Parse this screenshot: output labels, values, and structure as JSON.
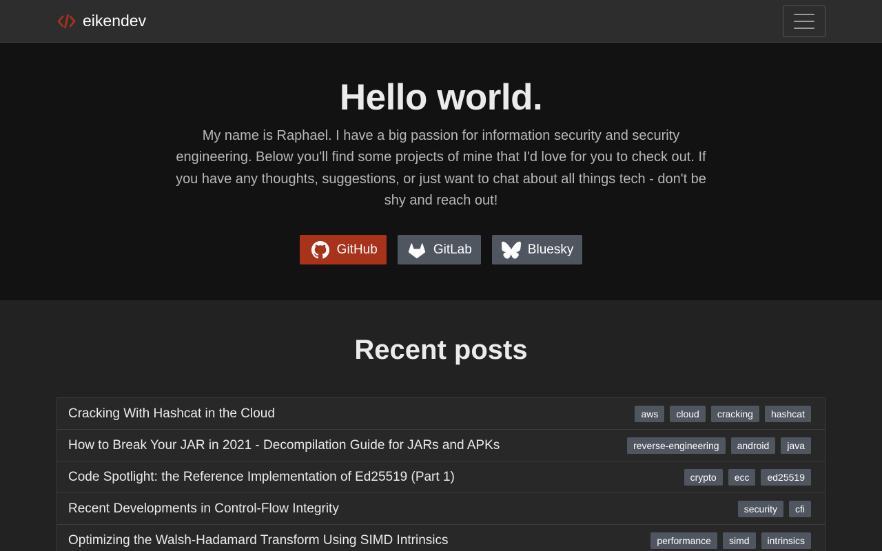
{
  "navbar": {
    "brand": "eikendev",
    "brand_icon": "code-icon",
    "menu_icon": "hamburger-icon",
    "brand_color": "#a9321b"
  },
  "hero": {
    "title": "Hello world.",
    "intro": "My name is Raphael. I have a big passion for information security and security engineering. Below you'll find some projects of mine that I'd love for you to check out. If you have any thoughts, suggestions, or just want to chat about all things tech - don't be shy and reach out!",
    "social": [
      {
        "label": "GitHub",
        "icon": "github-icon",
        "color": "#a9321b"
      },
      {
        "label": "GitLab",
        "icon": "gitlab-icon",
        "color": "#4f5660"
      },
      {
        "label": "Bluesky",
        "icon": "bluesky-icon",
        "color": "#4f5660"
      }
    ]
  },
  "posts": {
    "heading": "Recent posts",
    "items": [
      {
        "title": "Cracking With Hashcat in the Cloud",
        "tags": [
          "aws",
          "cloud",
          "cracking",
          "hashcat"
        ]
      },
      {
        "title": "How to Break Your JAR in 2021 - Decompilation Guide for JARs and APKs",
        "tags": [
          "reverse-engineering",
          "android",
          "java"
        ]
      },
      {
        "title": "Code Spotlight: the Reference Implementation of Ed25519 (Part 1)",
        "tags": [
          "crypto",
          "ecc",
          "ed25519"
        ]
      },
      {
        "title": "Recent Developments in Control-Flow Integrity",
        "tags": [
          "security",
          "cfi"
        ]
      },
      {
        "title": "Optimizing the Walsh-Hadamard Transform Using SIMD Intrinsics",
        "tags": [
          "performance",
          "simd",
          "intrinsics"
        ]
      }
    ]
  }
}
